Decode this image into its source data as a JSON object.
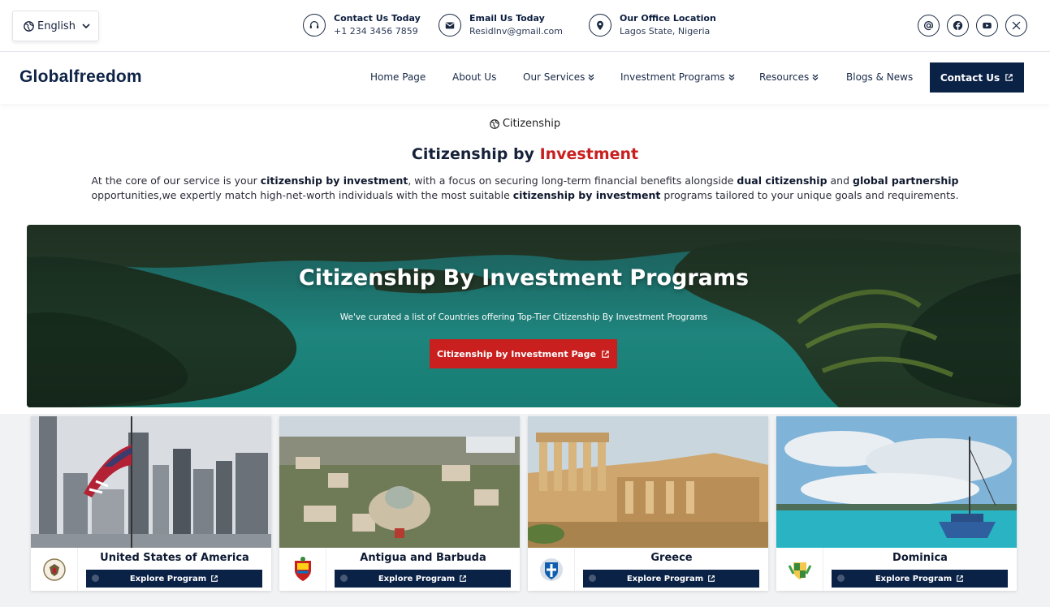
{
  "topbar": {
    "language": "English",
    "contacts": [
      {
        "title": "Contact Us Today",
        "value": "+1 234 3456 7859",
        "icon": "headset-icon"
      },
      {
        "title": "Email Us Today",
        "value": "ResidInv@gmail.com",
        "icon": "mail-icon"
      },
      {
        "title": "Our Office Location",
        "value": "Lagos State, Nigeria",
        "icon": "location-pin-icon"
      }
    ],
    "socials": [
      "at-sign-icon",
      "facebook-icon",
      "youtube-icon",
      "x-icon"
    ]
  },
  "nav": {
    "logo": "Globalfreedom",
    "links": [
      {
        "label": "Home Page",
        "dropdown": false
      },
      {
        "label": "About Us",
        "dropdown": false
      },
      {
        "label": "Our Services",
        "dropdown": true
      },
      {
        "label": "Investment Programs",
        "dropdown": true
      },
      {
        "label": "Resources",
        "dropdown": true
      },
      {
        "label": "Blogs & News",
        "dropdown": false
      }
    ],
    "contact_button": "Contact Us"
  },
  "intro": {
    "crumb": "Citizenship",
    "title_plain": "Citizenship by ",
    "title_accent": "Investment",
    "p1": "At the core of our service is your ",
    "b1": "citizenship by investment",
    "p2": ", with a focus on securing long-term financial benefits alongside ",
    "b2": "dual citizenship",
    "p3": " and ",
    "b3": "global partnership",
    "p4": " opportunities,we expertly match high-net-worth individuals with the most suitable ",
    "b4": "citizenship by investment",
    "p5": " programs tailored to your unique goals and requirements."
  },
  "hero": {
    "title": "Citizenship By Investment Programs",
    "subtitle": "We've curated a list of Countries offering Top-Tier Citizenship By Investment Programs",
    "button": "Citizenship by Investment Page"
  },
  "cards": [
    {
      "country": "United States of America",
      "button": "Explore Program"
    },
    {
      "country": "Antigua and Barbuda",
      "button": "Explore Program"
    },
    {
      "country": "Greece",
      "button": "Explore Program"
    },
    {
      "country": "Dominica",
      "button": "Explore Program"
    }
  ],
  "colors": {
    "navy": "#0b2247",
    "accent_red": "#c8201f"
  }
}
